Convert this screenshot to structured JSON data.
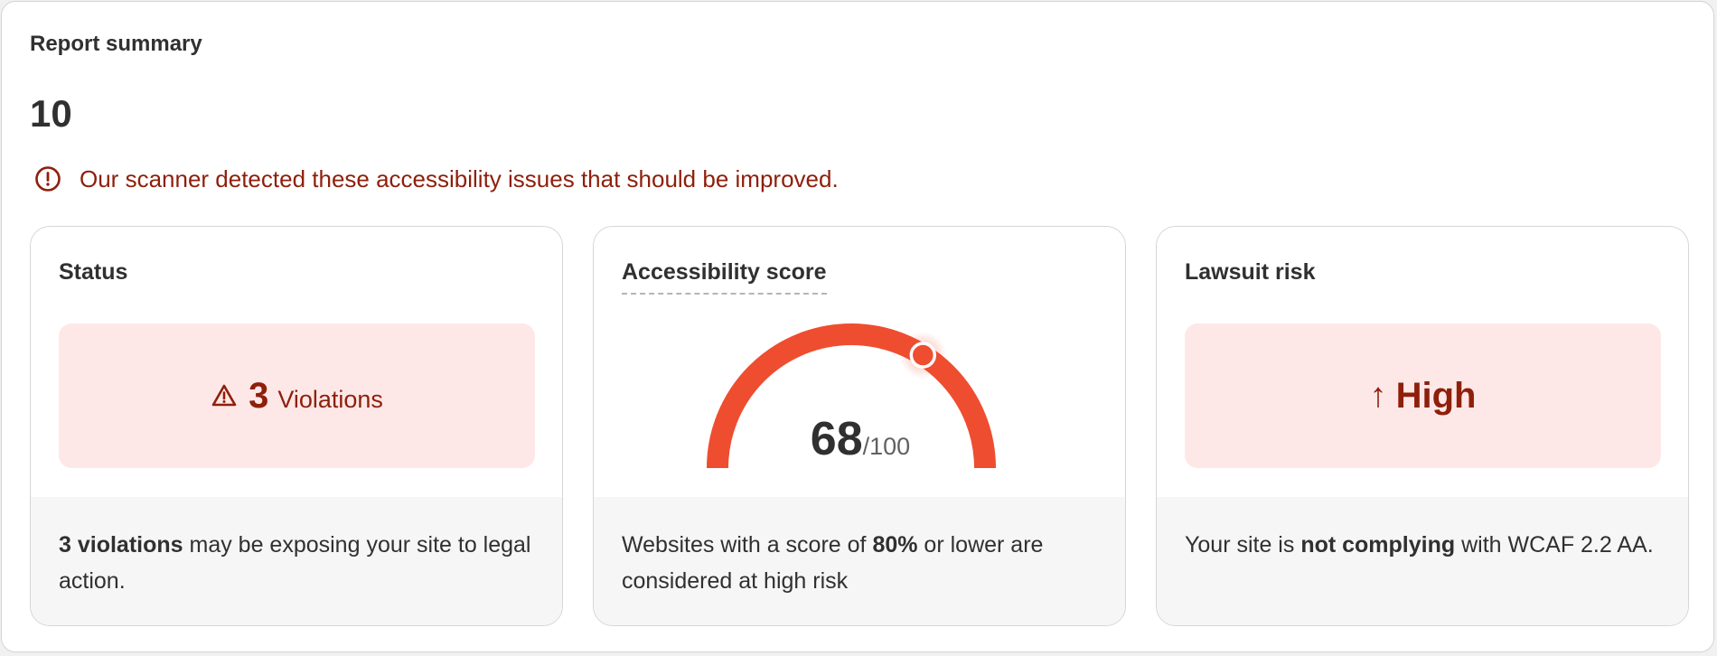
{
  "report": {
    "title": "Report summary",
    "count": "10"
  },
  "alert": {
    "icon": "alert-circle-icon",
    "text": "Our scanner detected these accessibility issues that should be improved."
  },
  "cards": {
    "status": {
      "title": "Status",
      "icon": "warning-triangle-icon",
      "violations_count": "3",
      "violations_label": "Violations",
      "footer_bold": "3 violations",
      "footer_rest": " may be exposing your site to legal action."
    },
    "score": {
      "title": "Accessibility score",
      "value": "68",
      "max": "/100",
      "score_fraction": 0.68,
      "footer_pre": "Websites with a score of ",
      "footer_bold": "80%",
      "footer_post": " or lower are considered at high risk"
    },
    "risk": {
      "title": "Lawsuit risk",
      "arrow": "↑",
      "level": "High",
      "footer_pre": "Your site is ",
      "footer_bold": "not complying",
      "footer_post": " with WCAF 2.2 AA."
    }
  },
  "colors": {
    "critical_text": "#8e1f0b",
    "critical_bg": "#fee8e7",
    "gauge": "#ef4d2f"
  }
}
